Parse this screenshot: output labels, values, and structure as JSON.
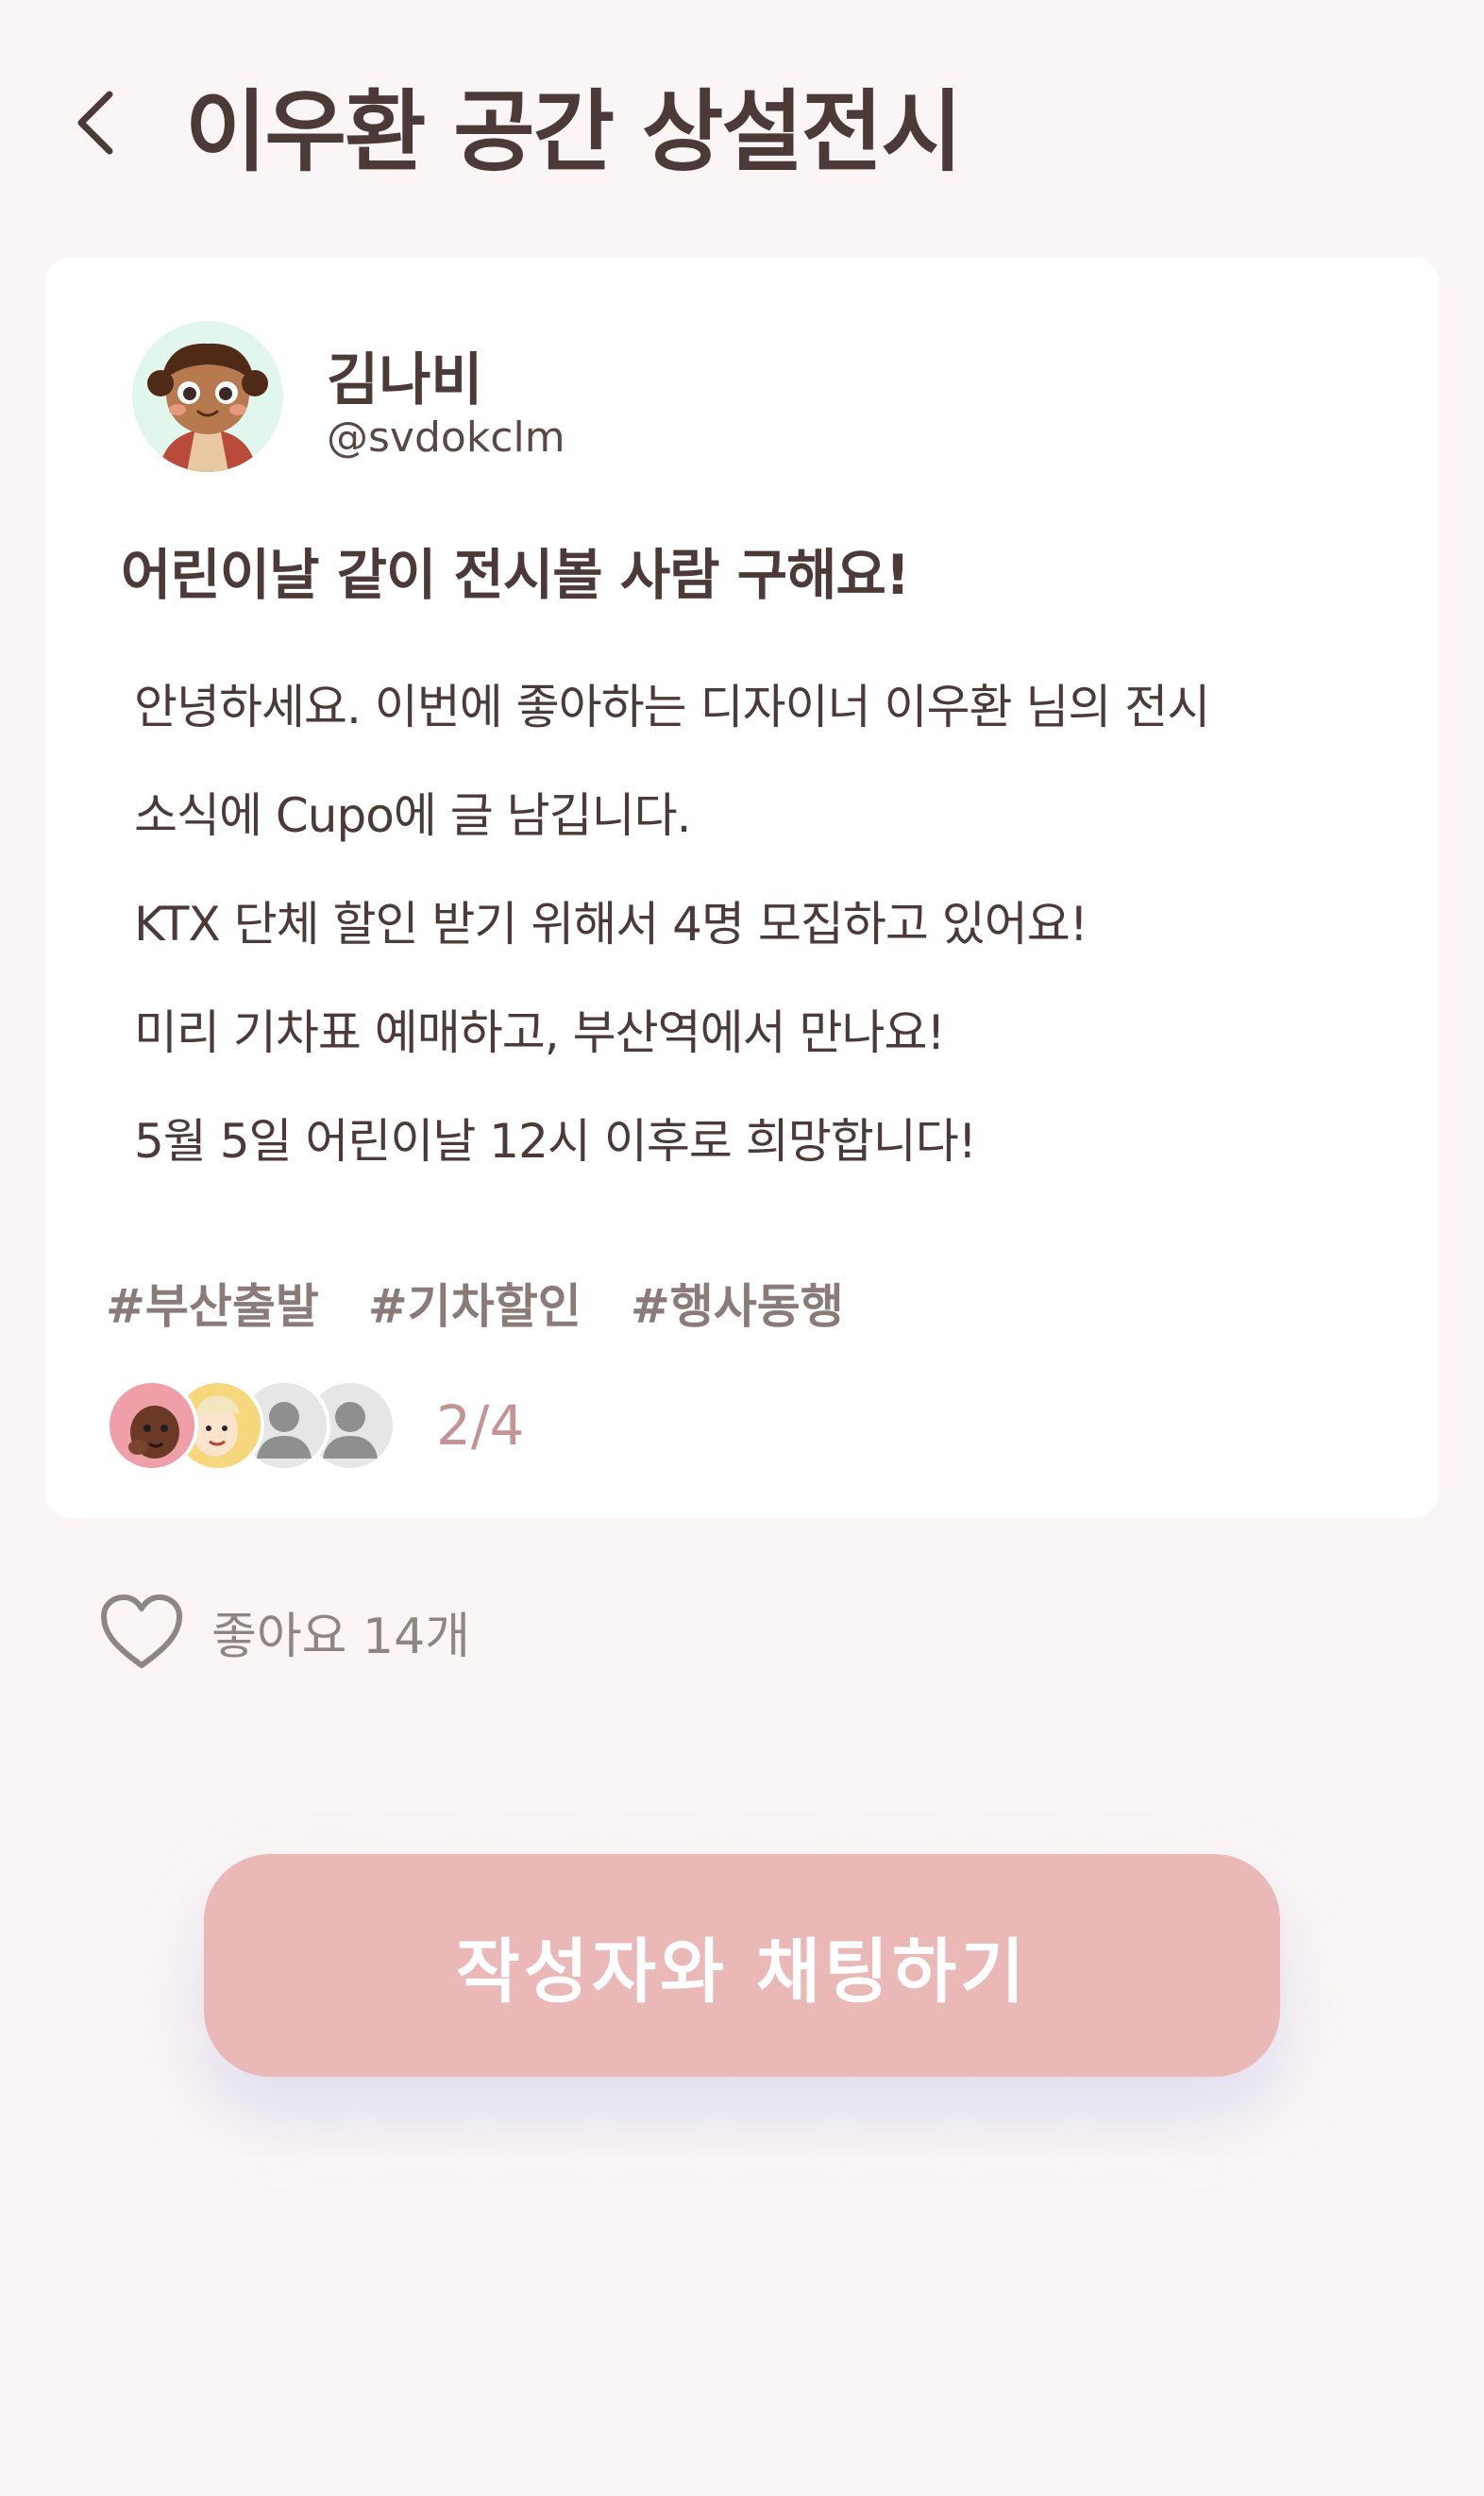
{
  "header": {
    "back_icon": "chevron-left-icon",
    "title": "이우환 공간 상설전시"
  },
  "post": {
    "author": {
      "name": "김나비",
      "handle": "@svdokclm"
    },
    "title": "어린이날 같이 전시볼 사람 구해요!",
    "body": [
      "안녕하세요. 이번에 좋아하는 디자이너 이우환 님의 전시",
      "소식에 Cupo에 글 남깁니다.",
      "KTX 단체 할인 받기 위해서 4명 모집하고 있어요!",
      "미리 기차표 예매하고,  부산역에서 만나요!",
      "5월 5일 어린이날 12시 이후로 희망합니다!"
    ],
    "tags": [
      "#부산출발",
      "#기차할인",
      "#행사동행"
    ],
    "participants": {
      "count_text": "2/4",
      "joined": 2,
      "capacity": 4
    }
  },
  "likes": {
    "icon": "heart-outline-icon",
    "label": "좋아요 14개"
  },
  "cta": {
    "label": "작성자와 채팅하기"
  },
  "colors": {
    "background": "#fbf6f5",
    "card": "#ffffff",
    "text": "#4b3a38",
    "accent": "#ebb8b8",
    "count": "#c49494"
  }
}
